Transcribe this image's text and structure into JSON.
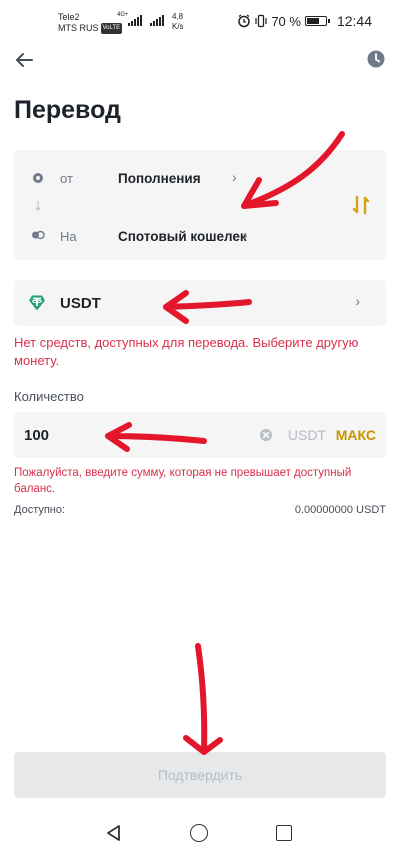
{
  "status_bar": {
    "carrier1": "Tele2",
    "carrier2": "MTS RUS",
    "volte": "VoLTE",
    "network_gen": "4G+",
    "speed_value": "4,8",
    "speed_unit": "K/s",
    "battery": "70 %",
    "battery_level": 0.7,
    "time": "12:44"
  },
  "header": {
    "title": "Перевод",
    "back_icon": "arrow-left-icon",
    "history_icon": "clock-icon"
  },
  "transfer": {
    "from_label": "от",
    "from_value": "Пополнения",
    "to_label": "На",
    "to_value": "Спотовый кошелек",
    "swap_icon": "swap-vertical-icon"
  },
  "coin": {
    "name": "USDT",
    "icon": "tether-icon",
    "error": "Нет средств, доступных для перевода. Выберите другую монету."
  },
  "amount": {
    "label": "Количество",
    "value": "100",
    "unit": "USDT",
    "max_label": "МАКС",
    "error": "Пожалуйста, введите сумму, которая не превышает доступный баланс.",
    "available_label": "Доступно:",
    "available_value": "0.00000000 USDT"
  },
  "confirm_label": "Подтвердить",
  "colors": {
    "accent": "#F0B90B",
    "error": "#D9304E",
    "tether": "#26A17B",
    "annotation": "#E3162B"
  }
}
